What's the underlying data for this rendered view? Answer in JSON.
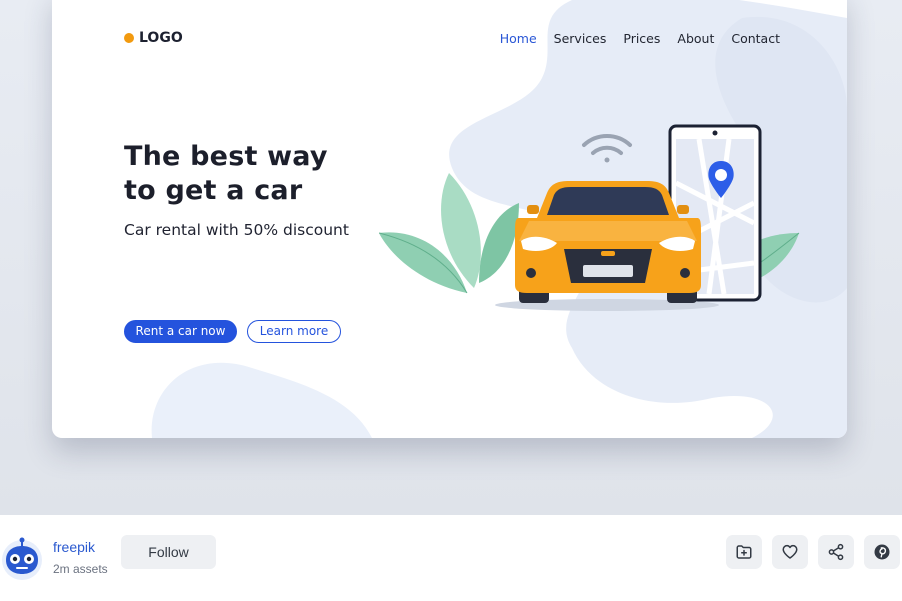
{
  "preview": {
    "logo": {
      "text": "LOGO",
      "icon": "orange-dot-icon"
    },
    "nav": [
      {
        "label": "Home",
        "active": true
      },
      {
        "label": "Services",
        "active": false
      },
      {
        "label": "Prices",
        "active": false
      },
      {
        "label": "About",
        "active": false
      },
      {
        "label": "Contact",
        "active": false
      }
    ],
    "hero": {
      "title_line1": "The best way",
      "title_line2": "to get a car",
      "subtitle": "Car rental with 50% discount"
    },
    "buttons": {
      "primary": "Rent a car now",
      "secondary": "Learn more"
    },
    "illustration_icons": [
      "leaf-icon",
      "wifi-icon",
      "car-icon",
      "smartphone-icon",
      "map-pin-icon"
    ]
  },
  "author": {
    "name": "freepik",
    "assets": "2m assets",
    "avatar_icon": "robot-avatar-icon",
    "follow_label": "Follow"
  },
  "actions": [
    {
      "name": "collection",
      "icon": "add-folder-icon"
    },
    {
      "name": "like",
      "icon": "heart-icon"
    },
    {
      "name": "share",
      "icon": "share-icon"
    },
    {
      "name": "pinterest",
      "icon": "pinterest-icon"
    }
  ],
  "colors": {
    "accent_blue": "#2453dd",
    "logo_orange": "#f29a0f",
    "car_orange": "#f7a21a",
    "text_dark": "#1c1f2b",
    "button_gray": "#eef0f3"
  }
}
